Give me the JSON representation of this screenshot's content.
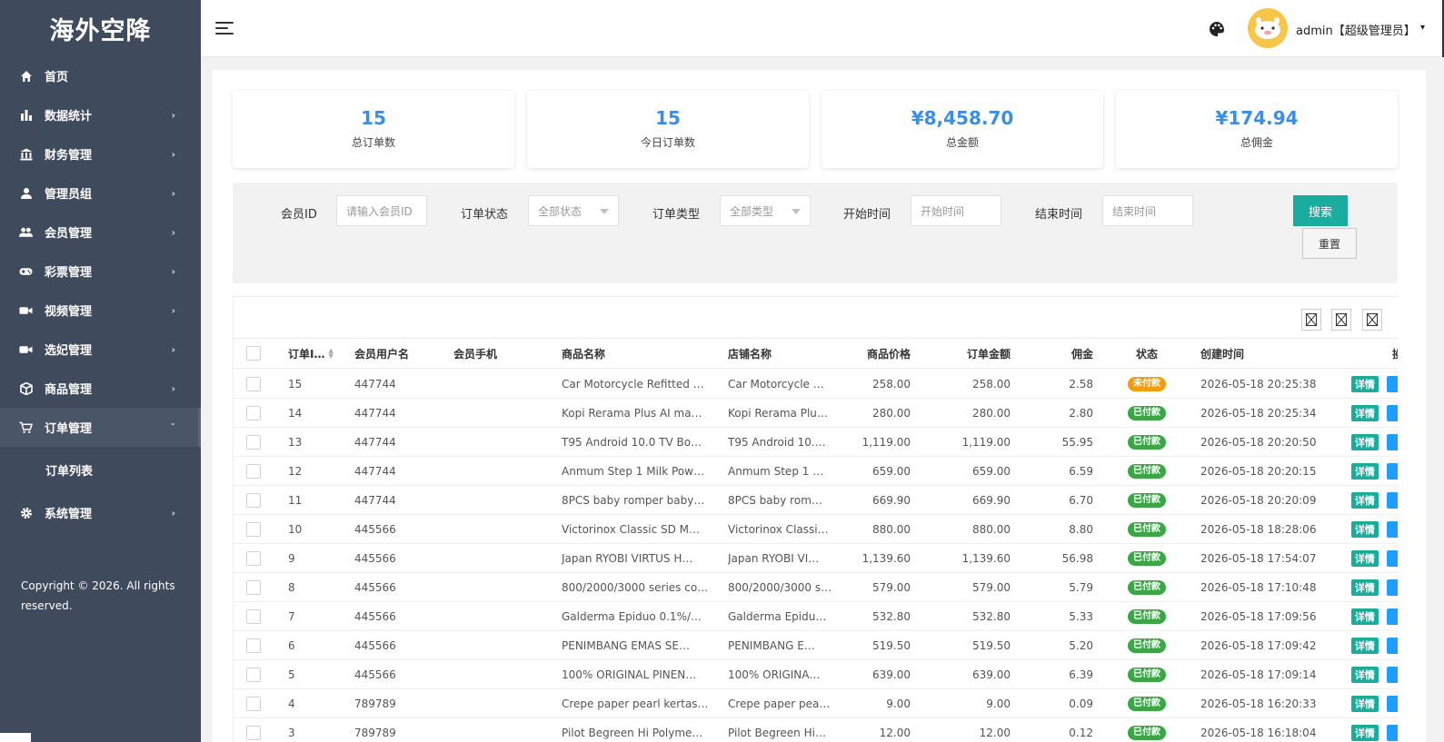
{
  "sidebar": {
    "brand": "海外空降",
    "items": [
      {
        "label": "首页",
        "icon": "home-icon",
        "chevron": ""
      },
      {
        "label": "数据统计",
        "icon": "bar-chart-icon",
        "chevron": "›"
      },
      {
        "label": "财务管理",
        "icon": "bank-icon",
        "chevron": "›"
      },
      {
        "label": "管理员组",
        "icon": "user-icon",
        "chevron": "›"
      },
      {
        "label": "会员管理",
        "icon": "users-icon",
        "chevron": "›"
      },
      {
        "label": "彩票管理",
        "icon": "gamepad-icon",
        "chevron": "›"
      },
      {
        "label": "视频管理",
        "icon": "video-icon",
        "chevron": "›"
      },
      {
        "label": "选妃管理",
        "icon": "video-icon",
        "chevron": "›"
      },
      {
        "label": "商品管理",
        "icon": "cube-icon",
        "chevron": "›"
      },
      {
        "label": "订单管理",
        "icon": "cart-icon",
        "chevron": "ˇ"
      }
    ],
    "submenu": {
      "label": "订单列表"
    },
    "system": {
      "label": "系统管理",
      "icon": "gear-icon",
      "chevron": "›"
    },
    "copyright": "Copyright © 2026. All rights reserved."
  },
  "header": {
    "user": "admin【超级管理员】",
    "caret": "▾"
  },
  "stats": [
    {
      "value": "15",
      "label": "总订单数"
    },
    {
      "value": "15",
      "label": "今日订单数"
    },
    {
      "value": "¥8,458.70",
      "label": "总金额"
    },
    {
      "value": "¥174.94",
      "label": "总佣金"
    }
  ],
  "filters": {
    "member_id": {
      "label": "会员ID",
      "placeholder": "请输入会员ID"
    },
    "status": {
      "label": "订单状态",
      "value": "全部状态"
    },
    "type": {
      "label": "订单类型",
      "value": "全部类型"
    },
    "start": {
      "label": "开始时间",
      "placeholder": "开始时间"
    },
    "end": {
      "label": "结束时间",
      "placeholder": "结束时间"
    },
    "search": "搜索",
    "reset": "重置"
  },
  "table": {
    "columns": {
      "id": "订单I…",
      "username": "会员用户名",
      "phone": "会员手机",
      "product": "商品名称",
      "shop": "店铺名称",
      "price": "商品价格",
      "amount": "订单金额",
      "commission": "佣金",
      "status": "状态",
      "created": "创建时间",
      "op": "操"
    },
    "detail_label": "详情",
    "rows": [
      {
        "id": "15",
        "username": "447744",
        "product": "Car Motorcycle Refitted …",
        "shop": "Car Motorcycle …",
        "price": "258.00",
        "amount": "258.00",
        "commission": "2.58",
        "status": "未付款",
        "paid": false,
        "created": "2026-05-18 20:25:38"
      },
      {
        "id": "14",
        "username": "447744",
        "product": "Kopi Rerama Plus AI ma…",
        "shop": "Kopi Rerama Plu…",
        "price": "280.00",
        "amount": "280.00",
        "commission": "2.80",
        "status": "已付款",
        "paid": true,
        "created": "2026-05-18 20:25:34"
      },
      {
        "id": "13",
        "username": "447744",
        "product": "T95 Android 10.0 TV Bo…",
        "shop": "T95 Android 10.…",
        "price": "1,119.00",
        "amount": "1,119.00",
        "commission": "55.95",
        "status": "已付款",
        "paid": true,
        "created": "2026-05-18 20:20:50"
      },
      {
        "id": "12",
        "username": "447744",
        "product": "Anmum Step 1 Milk Pow…",
        "shop": "Anmum Step 1 …",
        "price": "659.00",
        "amount": "659.00",
        "commission": "6.59",
        "status": "已付款",
        "paid": true,
        "created": "2026-05-18 20:20:15"
      },
      {
        "id": "11",
        "username": "447744",
        "product": "8PCS baby romper baby…",
        "shop": "8PCS baby rom…",
        "price": "669.90",
        "amount": "669.90",
        "commission": "6.70",
        "status": "已付款",
        "paid": true,
        "created": "2026-05-18 20:20:09"
      },
      {
        "id": "10",
        "username": "445566",
        "product": "Victorinox Classic SD M…",
        "shop": "Victorinox Classi…",
        "price": "880.00",
        "amount": "880.00",
        "commission": "8.80",
        "status": "已付款",
        "paid": true,
        "created": "2026-05-18 18:28:06"
      },
      {
        "id": "9",
        "username": "445566",
        "product": "Japan RYOBI VIRTUS H…",
        "shop": "Japan RYOBI VI…",
        "price": "1,139.60",
        "amount": "1,139.60",
        "commission": "56.98",
        "status": "已付款",
        "paid": true,
        "created": "2026-05-18 17:54:07"
      },
      {
        "id": "8",
        "username": "445566",
        "product": "800/2000/3000 series co…",
        "shop": "800/2000/3000 s…",
        "price": "579.00",
        "amount": "579.00",
        "commission": "5.79",
        "status": "已付款",
        "paid": true,
        "created": "2026-05-18 17:10:48"
      },
      {
        "id": "7",
        "username": "445566",
        "product": "Galderma Epiduo 0.1%/…",
        "shop": "Galderma Epidu…",
        "price": "532.80",
        "amount": "532.80",
        "commission": "5.33",
        "status": "已付款",
        "paid": true,
        "created": "2026-05-18 17:09:56"
      },
      {
        "id": "6",
        "username": "445566",
        "product": "PENIMBANG EMAS SE…",
        "shop": "PENIMBANG E…",
        "price": "519.50",
        "amount": "519.50",
        "commission": "5.20",
        "status": "已付款",
        "paid": true,
        "created": "2026-05-18 17:09:42"
      },
      {
        "id": "5",
        "username": "445566",
        "product": "100% ORIGINAL PINEN…",
        "shop": "100% ORIGINA…",
        "price": "639.00",
        "amount": "639.00",
        "commission": "6.39",
        "status": "已付款",
        "paid": true,
        "created": "2026-05-18 17:09:14"
      },
      {
        "id": "4",
        "username": "789789",
        "product": "Crepe paper pearl kertas…",
        "shop": "Crepe paper pea…",
        "price": "9.00",
        "amount": "9.00",
        "commission": "0.09",
        "status": "已付款",
        "paid": true,
        "created": "2026-05-18 16:20:33"
      },
      {
        "id": "3",
        "username": "789789",
        "product": "Pilot Begreen Hi Polyme…",
        "shop": "Pilot Begreen Hi…",
        "price": "12.00",
        "amount": "12.00",
        "commission": "0.12",
        "status": "已付款",
        "paid": true,
        "created": "2026-05-18 16:18:04"
      }
    ]
  },
  "colors": {
    "sidebar_bg": "#3f4a5c",
    "accent": "#1aac9c",
    "stat_value": "#3a8ee6",
    "paid": "#3aa745",
    "unpaid": "#f39c12"
  }
}
